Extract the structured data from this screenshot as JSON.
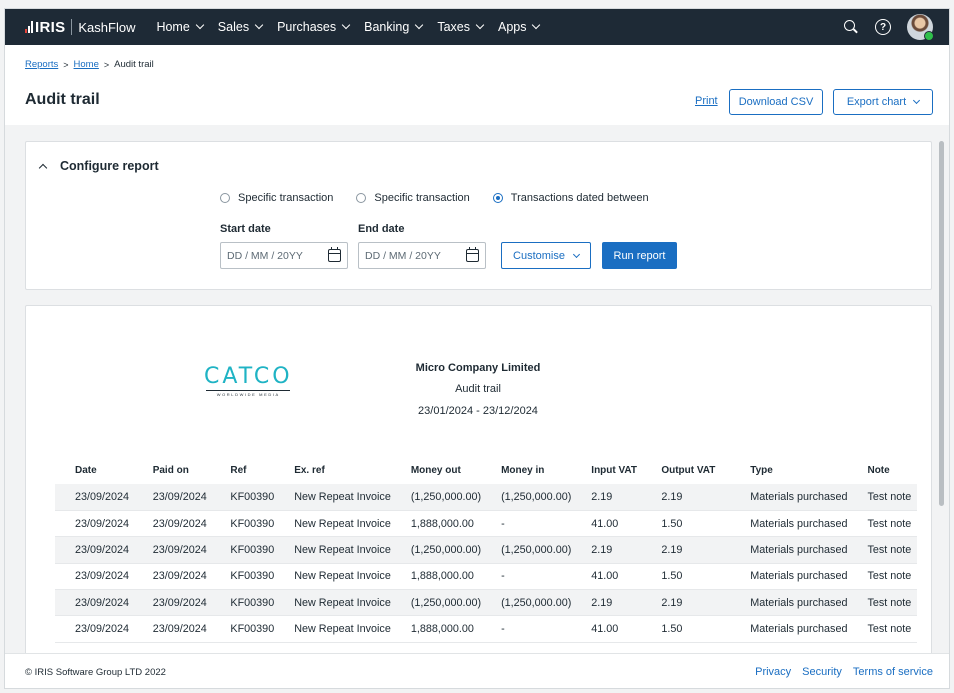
{
  "nav": {
    "brand": "IRIS",
    "product": "KashFlow",
    "menu": [
      "Home",
      "Sales",
      "Purchases",
      "Banking",
      "Taxes",
      "Apps"
    ],
    "icons": [
      "search-icon",
      "help-icon",
      "avatar"
    ]
  },
  "breadcrumb": {
    "reports": "Reports",
    "home": "Home",
    "current": "Audit trail",
    "sep": ">"
  },
  "header": {
    "title": "Audit trail",
    "print": "Print",
    "download_csv": "Download CSV",
    "export_chart": "Export chart"
  },
  "config": {
    "title": "Configure report",
    "radios": [
      "Specific transaction",
      "Specific transaction",
      "Transactions dated between"
    ],
    "selected_radio": 2,
    "start_label": "Start date",
    "end_label": "End date",
    "start_placeholder": "DD / MM / 20YY",
    "end_placeholder": "DD / MM / 20YY",
    "customise": "Customise",
    "run": "Run report"
  },
  "report": {
    "logo_text": "CATCO",
    "logo_sub": "WORLDWIDE MEDIA",
    "company": "Micro Company Limited",
    "subtitle": "Audit trail",
    "range": "23/01/2024 - 23/12/2024",
    "columns": [
      "Date",
      "Paid on",
      "Ref",
      "Ex. ref",
      "Money out",
      "Money in",
      "Input VAT",
      "Output VAT",
      "Type",
      "Note"
    ],
    "rows": [
      [
        "23/09/2024",
        "23/09/2024",
        "KF00390",
        "New Repeat Invoice",
        "(1,250,000.00)",
        "(1,250,000.00)",
        "2.19",
        "2.19",
        "Materials purchased",
        "Test note"
      ],
      [
        "23/09/2024",
        "23/09/2024",
        "KF00390",
        "New Repeat Invoice",
        "1,888,000.00",
        "-",
        "41.00",
        "1.50",
        "Materials purchased",
        "Test note"
      ],
      [
        "23/09/2024",
        "23/09/2024",
        "KF00390",
        "New Repeat Invoice",
        "(1,250,000.00)",
        "(1,250,000.00)",
        "2.19",
        "2.19",
        "Materials purchased",
        "Test note"
      ],
      [
        "23/09/2024",
        "23/09/2024",
        "KF00390",
        "New Repeat Invoice",
        "1,888,000.00",
        "-",
        "41.00",
        "1.50",
        "Materials purchased",
        "Test note"
      ],
      [
        "23/09/2024",
        "23/09/2024",
        "KF00390",
        "New Repeat Invoice",
        "(1,250,000.00)",
        "(1,250,000.00)",
        "2.19",
        "2.19",
        "Materials purchased",
        "Test note"
      ],
      [
        "23/09/2024",
        "23/09/2024",
        "KF00390",
        "New Repeat Invoice",
        "1,888,000.00",
        "-",
        "41.00",
        "1.50",
        "Materials purchased",
        "Test note"
      ]
    ]
  },
  "footer": {
    "copyright": "© IRIS Software Group LTD 2022",
    "links": [
      "Privacy",
      "Security",
      "Terms of service"
    ]
  },
  "colors": {
    "nav_bg": "#1e2a36",
    "accent": "#1a6ec2",
    "logo_teal": "#1fb3c4",
    "logo_red": "#e6443a"
  }
}
